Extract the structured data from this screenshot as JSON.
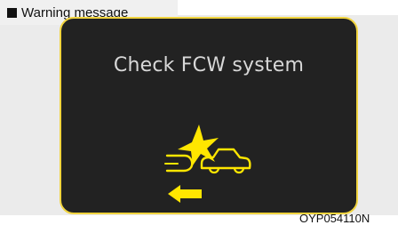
{
  "caption": {
    "text": "Warning message"
  },
  "display": {
    "message": "Check FCW system",
    "icon": "fcw-collision-warning-icon"
  },
  "footer": {
    "code": "OYP054110N"
  },
  "colors": {
    "indicator_yellow": "#ffe600",
    "frame_yellow": "#f1d43f",
    "screen_dark": "#222222"
  }
}
